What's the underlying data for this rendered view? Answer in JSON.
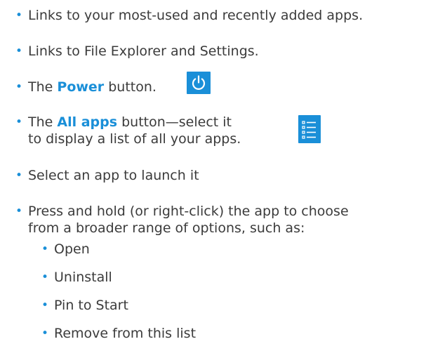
{
  "bullets": [
    {
      "text": "Links to your most-used and recently added apps."
    },
    {
      "text": "Links to File Explorer and Settings."
    },
    {
      "prefix": "The ",
      "keyword": "Power",
      "suffix": " button."
    },
    {
      "prefix": "The ",
      "keyword": "All apps",
      "suffix": " button—select it",
      "line2": "to display a list of all your apps."
    },
    {
      "text": "Select an app to launch it"
    },
    {
      "line1": "Press and hold (or right-click) the app to choose",
      "line2": "from a broader range of options, such as:"
    }
  ],
  "sub_bullets": [
    {
      "text": "Open"
    },
    {
      "text": "Uninstall"
    },
    {
      "text": "Pin to Start"
    },
    {
      "text": "Remove from this list"
    }
  ],
  "icons": {
    "power": "power-icon",
    "all_apps": "all-apps-list-icon"
  },
  "colors": {
    "accent": "#1a8fd8",
    "text": "#3b3b3b",
    "background": "#ffffff"
  }
}
